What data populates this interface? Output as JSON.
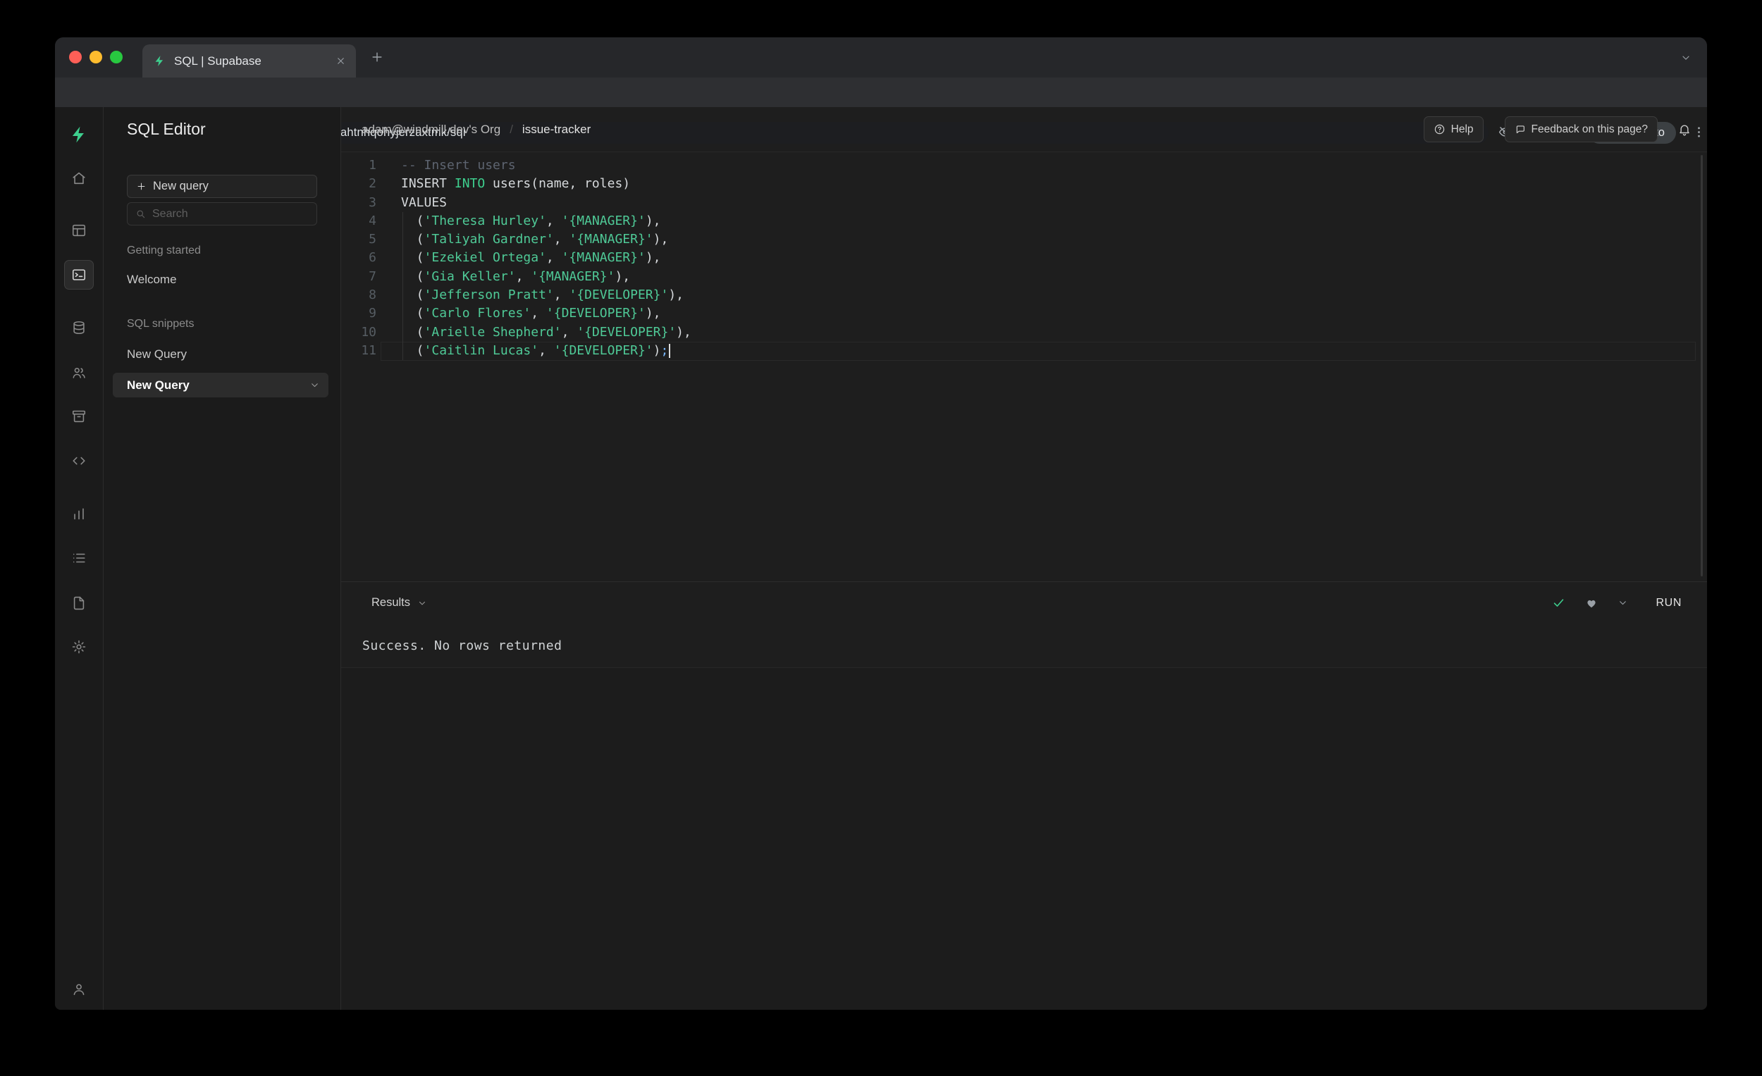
{
  "browser": {
    "tab_title": "SQL | Supabase",
    "url": "app.supabase.com/project/azahtnhqohyjerzaxtmk/sql",
    "incognito_label": "Incognito"
  },
  "app": {
    "rail": {
      "selected": "sql-editor",
      "icons": [
        "supabase-logo",
        "home",
        "table-editor",
        "sql-editor",
        "database",
        "auth",
        "storage",
        "api",
        "reports",
        "logs",
        "docs",
        "settings",
        "account"
      ]
    },
    "sidebar": {
      "title": "SQL Editor",
      "new_query_button": "New query",
      "search_placeholder": "Search",
      "sections": [
        {
          "label": "Getting started",
          "items": [
            {
              "label": "Welcome",
              "selected": false
            }
          ]
        },
        {
          "label": "SQL snippets",
          "items": [
            {
              "label": "New Query",
              "selected": false
            },
            {
              "label": "New Query",
              "selected": true
            }
          ]
        }
      ]
    },
    "header": {
      "org": "adam@windmill.dev's Org",
      "separator": "/",
      "project": "issue-tracker",
      "help_label": "Help",
      "feedback_label": "Feedback on this page?"
    },
    "editor": {
      "language": "sql",
      "lines": [
        [
          {
            "t": "-- Insert users",
            "c": "cm"
          }
        ],
        [
          {
            "t": "INSERT ",
            "c": "tx"
          },
          {
            "t": "INTO",
            "c": "kw"
          },
          {
            "t": " users(name, roles)",
            "c": "tx"
          }
        ],
        [
          {
            "t": "VALUES",
            "c": "tx"
          }
        ],
        [
          {
            "t": "  (",
            "c": "tx"
          },
          {
            "t": "'Theresa Hurley'",
            "c": "st"
          },
          {
            "t": ", ",
            "c": "tx"
          },
          {
            "t": "'{MANAGER}'",
            "c": "st"
          },
          {
            "t": "),",
            "c": "tx"
          }
        ],
        [
          {
            "t": "  (",
            "c": "tx"
          },
          {
            "t": "'Taliyah Gardner'",
            "c": "st"
          },
          {
            "t": ", ",
            "c": "tx"
          },
          {
            "t": "'{MANAGER}'",
            "c": "st"
          },
          {
            "t": "),",
            "c": "tx"
          }
        ],
        [
          {
            "t": "  (",
            "c": "tx"
          },
          {
            "t": "'Ezekiel Ortega'",
            "c": "st"
          },
          {
            "t": ", ",
            "c": "tx"
          },
          {
            "t": "'{MANAGER}'",
            "c": "st"
          },
          {
            "t": "),",
            "c": "tx"
          }
        ],
        [
          {
            "t": "  (",
            "c": "tx"
          },
          {
            "t": "'Gia Keller'",
            "c": "st"
          },
          {
            "t": ", ",
            "c": "tx"
          },
          {
            "t": "'{MANAGER}'",
            "c": "st"
          },
          {
            "t": "),",
            "c": "tx"
          }
        ],
        [
          {
            "t": "  (",
            "c": "tx"
          },
          {
            "t": "'Jefferson Pratt'",
            "c": "st"
          },
          {
            "t": ", ",
            "c": "tx"
          },
          {
            "t": "'{DEVELOPER}'",
            "c": "st"
          },
          {
            "t": "),",
            "c": "tx"
          }
        ],
        [
          {
            "t": "  (",
            "c": "tx"
          },
          {
            "t": "'Carlo Flores'",
            "c": "st"
          },
          {
            "t": ", ",
            "c": "tx"
          },
          {
            "t": "'{DEVELOPER}'",
            "c": "st"
          },
          {
            "t": "),",
            "c": "tx"
          }
        ],
        [
          {
            "t": "  (",
            "c": "tx"
          },
          {
            "t": "'Arielle Shepherd'",
            "c": "st"
          },
          {
            "t": ", ",
            "c": "tx"
          },
          {
            "t": "'{DEVELOPER}'",
            "c": "st"
          },
          {
            "t": "),",
            "c": "tx"
          }
        ],
        [
          {
            "t": "  (",
            "c": "tx"
          },
          {
            "t": "'Caitlin Lucas'",
            "c": "st"
          },
          {
            "t": ", ",
            "c": "tx"
          },
          {
            "t": "'{DEVELOPER}'",
            "c": "st"
          },
          {
            "t": ")",
            "c": "tx"
          },
          {
            "t": ";",
            "c": "sc"
          }
        ]
      ],
      "cursor_line": 11
    },
    "results": {
      "label": "Results",
      "run_label": "RUN",
      "message": "Success. No rows returned"
    }
  },
  "colors": {
    "accent_green": "#3ecf8e",
    "editor_keyword": "#3ecf8e",
    "editor_string": "#4fca97",
    "traffic_red": "#ff5f57",
    "traffic_yellow": "#febc2e",
    "traffic_green": "#28c840"
  }
}
